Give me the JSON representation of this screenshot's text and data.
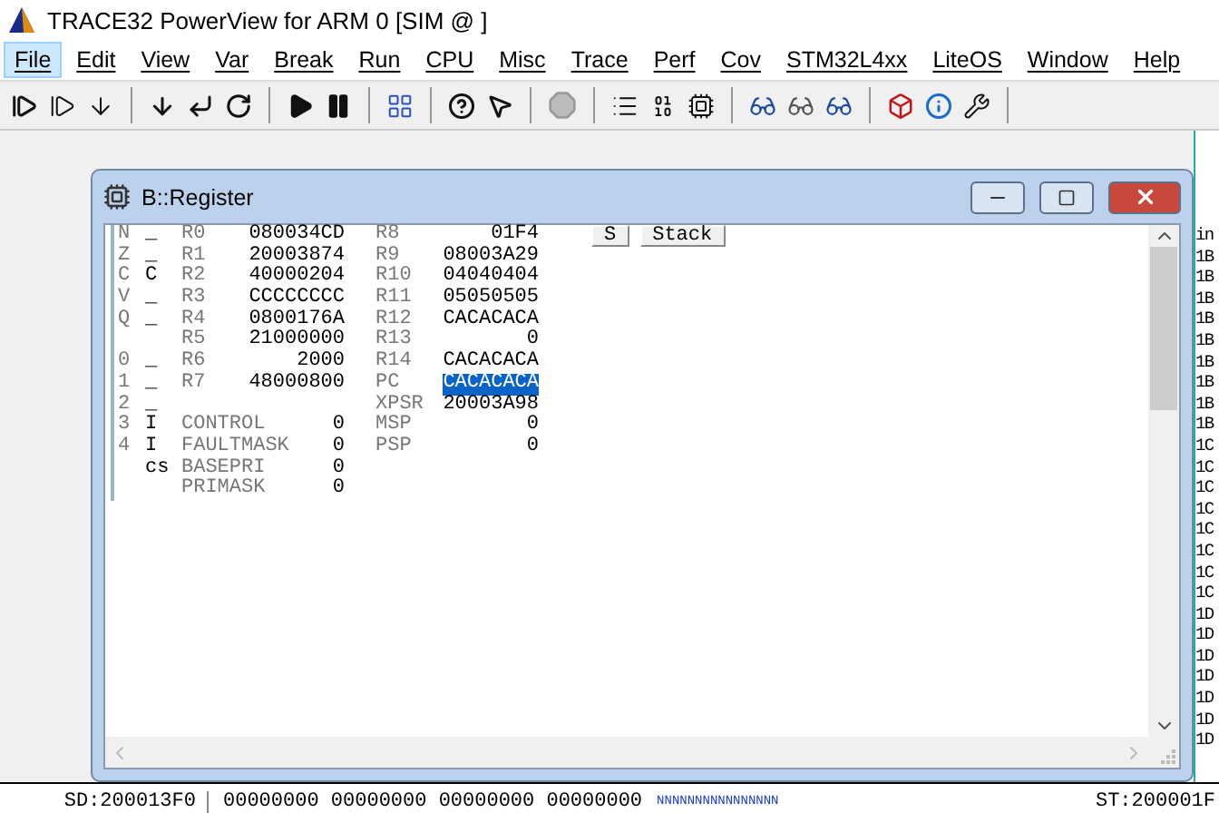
{
  "app": {
    "title": "TRACE32 PowerView for ARM 0 [SIM @ ]"
  },
  "menu": [
    {
      "label": "File",
      "selected": true
    },
    {
      "label": "Edit",
      "selected": false
    },
    {
      "label": "View",
      "selected": false
    },
    {
      "label": "Var",
      "selected": false
    },
    {
      "label": "Break",
      "selected": false
    },
    {
      "label": "Run",
      "selected": false
    },
    {
      "label": "CPU",
      "selected": false
    },
    {
      "label": "Misc",
      "selected": false
    },
    {
      "label": "Trace",
      "selected": false
    },
    {
      "label": "Perf",
      "selected": false
    },
    {
      "label": "Cov",
      "selected": false
    },
    {
      "label": "STM32L4xx",
      "selected": false
    },
    {
      "label": "LiteOS",
      "selected": false
    },
    {
      "label": "Window",
      "selected": false
    },
    {
      "label": "Help",
      "selected": false
    }
  ],
  "register_window": {
    "title": "B::Register",
    "buttons": [
      "S",
      "Stack"
    ],
    "rows": [
      {
        "flag": "N",
        "flag_value": "_",
        "name": "R0",
        "value": "080034CD",
        "name2": "R8",
        "value2": "01F4",
        "selected": false
      },
      {
        "flag": "Z",
        "flag_value": "_",
        "name": "R1",
        "value": "20003874",
        "name2": "R9",
        "value2": "08003A29",
        "selected": false
      },
      {
        "flag": "C",
        "flag_value": "C",
        "name": "R2",
        "value": "40000204",
        "name2": "R10",
        "value2": "04040404",
        "selected": false
      },
      {
        "flag": "V",
        "flag_value": "_",
        "name": "R3",
        "value": "CCCCCCCC",
        "name2": "R11",
        "value2": "05050505",
        "selected": false
      },
      {
        "flag": "Q",
        "flag_value": "_",
        "name": "R4",
        "value": "0800176A",
        "name2": "R12",
        "value2": "CACACACA",
        "selected": false
      },
      {
        "name": "R5",
        "value": "21000000",
        "name2": "R13",
        "value2": "0",
        "selected": false
      },
      {
        "flag": "0",
        "flag_value": "_",
        "name": "R6",
        "value": "2000",
        "name2": "R14",
        "value2": "CACACACA",
        "selected": false
      },
      {
        "flag": "1",
        "flag_value": "_",
        "name": "R7",
        "value": "48000800",
        "name2": "PC",
        "value2": "CACACACA",
        "selected": true
      },
      {
        "flag": "2",
        "flag_value": "_",
        "name2": "XPSR",
        "value2": "20003A98",
        "selected": false
      },
      {
        "flag": "3",
        "flag_value": "I",
        "name": "CONTROL",
        "value": "0",
        "name2": "MSP",
        "value2": "0",
        "selected": false
      },
      {
        "flag": "4",
        "flag_value": "I",
        "name": "FAULTMASK",
        "value": "0",
        "name2": "PSP",
        "value2": "0",
        "selected": false
      },
      {
        "flag_value": "cs",
        "name": "BASEPRI",
        "value": "0",
        "selected": false
      },
      {
        "name": "PRIMASK",
        "value": "0",
        "selected": false
      }
    ]
  },
  "background_window": {
    "column_1": [
      "in",
      "1B",
      "1B",
      "1B",
      "1B",
      "1B",
      "1B",
      "1B",
      "1B",
      "1B",
      "1C",
      "1C",
      "1C",
      "1C",
      "1C",
      "1C",
      "1C",
      "1C",
      "1D",
      "1D",
      "1D",
      "1D",
      "1D",
      "1D",
      "1D"
    ],
    "memory_line": {
      "address": "SD:200013F0",
      "data": "00000000 00000000 00000000 00000000",
      "ascii": "NNNNNNNNNNNNNNNN"
    },
    "address_2": "ST:200001F"
  }
}
